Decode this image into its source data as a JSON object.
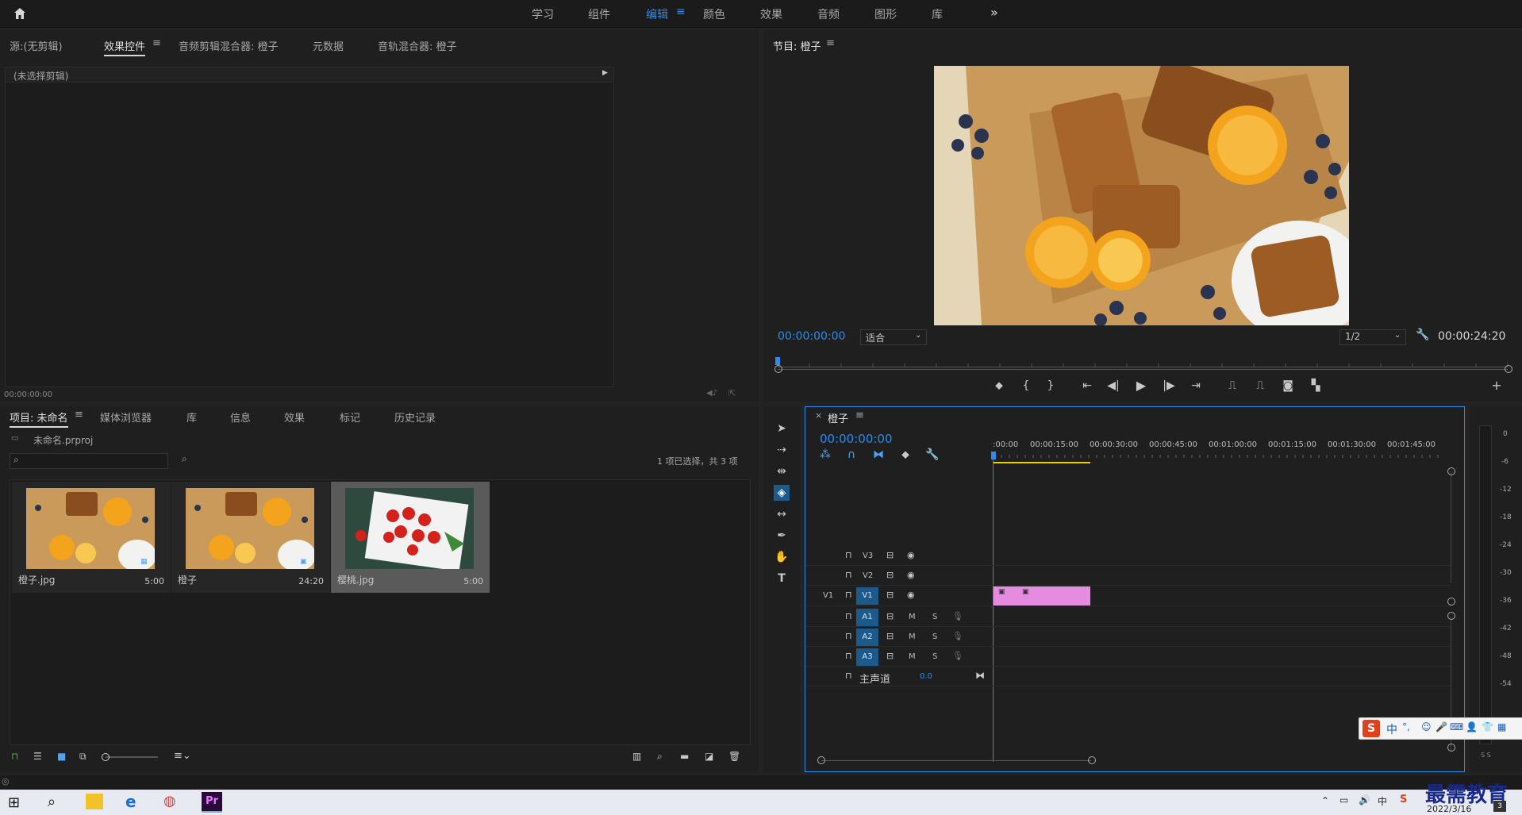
{
  "workspace_tabs": [
    "学习",
    "组件",
    "编辑",
    "颜色",
    "效果",
    "音频",
    "图形",
    "库"
  ],
  "workspace_more": "»",
  "source_panel": {
    "tabs": [
      "源:(无剪辑)",
      "效果控件",
      "音频剪辑混合器: 橙子",
      "元数据",
      "音轨混合器: 橙子"
    ],
    "no_clip": "(未选择剪辑)",
    "timecode": "00:00:00:00"
  },
  "program_panel": {
    "title": "节目: 橙子",
    "timecode_current": "00:00:00:00",
    "timecode_duration": "00:00:24:20",
    "fit_label": "适合",
    "resolution": "1/2"
  },
  "project_panel": {
    "tabs": [
      "项目: 未命名",
      "媒体浏览器",
      "库",
      "信息",
      "效果",
      "标记",
      "历史记录"
    ],
    "project_file": "未命名.prproj",
    "search_placeholder": "",
    "selection_status": "1 项已选择，共 3 项",
    "items": [
      {
        "name": "橙子.jpg",
        "duration": "5:00"
      },
      {
        "name": "橙子",
        "duration": "24:20"
      },
      {
        "name": "樱桃.jpg",
        "duration": "5:00"
      }
    ]
  },
  "timeline_panel": {
    "title": "橙子",
    "timecode": "00:00:00:00",
    "ruler_labels": [
      ":00:00",
      "00:00:15:00",
      "00:00:30:00",
      "00:00:45:00",
      "00:01:00:00",
      "00:01:15:00",
      "00:01:30:00",
      "00:01:45:00"
    ],
    "video_tracks": [
      "V3",
      "V2",
      "V1"
    ],
    "source_patch": "V1",
    "audio_tracks": [
      "A1",
      "A2",
      "A3"
    ],
    "mute_label": "M",
    "solo_label": "S",
    "master_label": "主声道",
    "master_value": "0.0"
  },
  "meter_labels": [
    "0",
    "-6",
    "-12",
    "-18",
    "-24",
    "-30",
    "-36",
    "-42",
    "-48",
    "-54"
  ],
  "meter_footer": "S S",
  "ime": {
    "label": "中",
    "punct": "°,"
  },
  "watermark": "最需教育",
  "taskbar": {
    "date": "2022/3/16",
    "notif_count": "3"
  },
  "colors": {
    "accent": "#2d8ceb",
    "clip": "#e58be0",
    "bg": "#1f1f1f"
  }
}
